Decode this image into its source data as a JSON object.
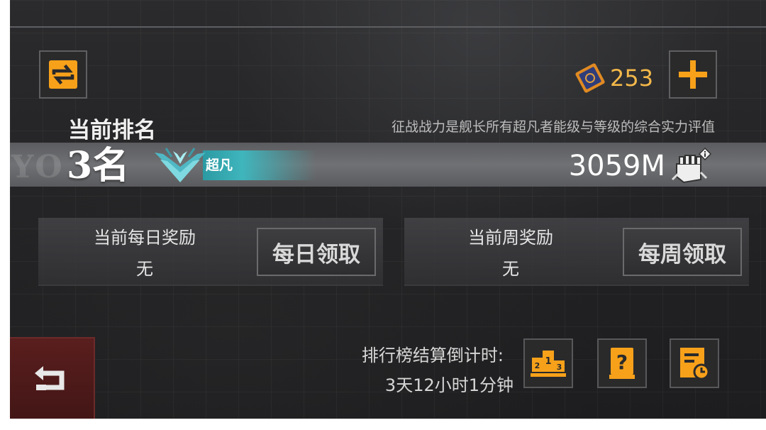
{
  "currency": {
    "icon": "ticket-icon",
    "amount": "253"
  },
  "header": {
    "rank_label": "当前排名",
    "description": "征战战力是舰长所有超凡者能级与等级的综合实力评值"
  },
  "rank": {
    "value": "3名",
    "watermark": "YO",
    "tier_label": "超凡",
    "power": "3059M"
  },
  "rewards": {
    "daily": {
      "title": "当前每日奖励",
      "value": "无",
      "button_label": "每日领取"
    },
    "weekly": {
      "title": "当前周奖励",
      "value": "无",
      "button_label": "每周领取"
    }
  },
  "countdown": {
    "label": "排行榜结算倒计时:",
    "value": "3天12小时1分钟"
  },
  "icons": {
    "swap": "swap-icon",
    "plus": "plus-icon",
    "tier": "tier-wings-icon",
    "power_info": "fist-info-icon",
    "back": "back-arrow-icon",
    "podium": "podium-icon",
    "help": "help-book-icon",
    "history": "history-clock-icon"
  },
  "colors": {
    "accent_orange": "#f7a11a",
    "currency_text": "#f3b84a",
    "tier_teal": "#3fb5bc",
    "back_red": "#4f1a1a"
  }
}
